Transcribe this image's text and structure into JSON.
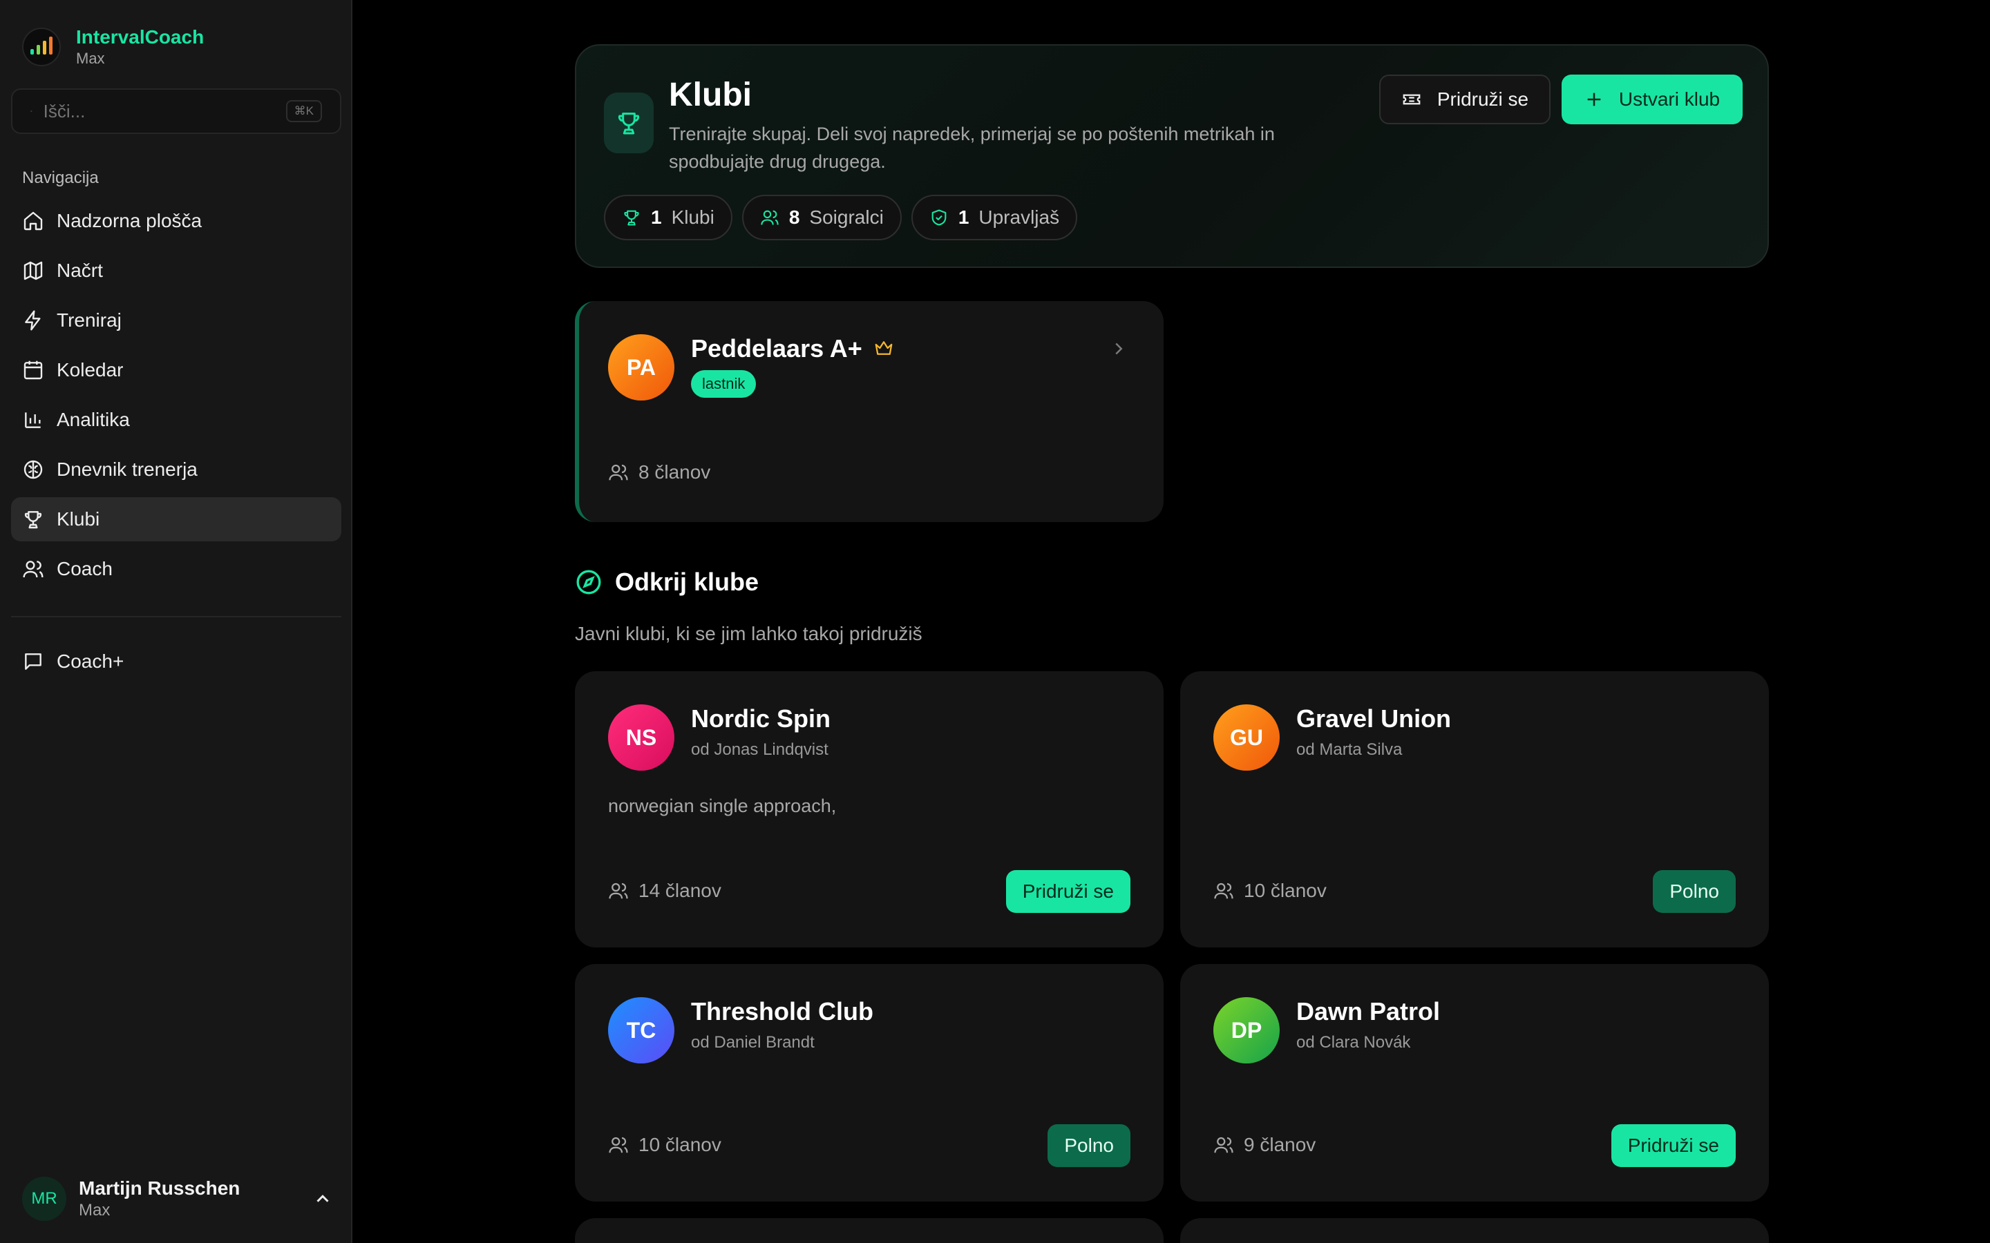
{
  "app": {
    "name": "IntervalCoach",
    "subtitle": "Max"
  },
  "search": {
    "placeholder": "Išči...",
    "shortcut": "⌘K"
  },
  "nav": {
    "title": "Navigacija",
    "items": [
      {
        "label": "Nadzorna plošča",
        "icon": "home-icon"
      },
      {
        "label": "Načrt",
        "icon": "map-icon"
      },
      {
        "label": "Treniraj",
        "icon": "bolt-icon"
      },
      {
        "label": "Koledar",
        "icon": "calendar-icon"
      },
      {
        "label": "Analitika",
        "icon": "bar-chart-icon"
      },
      {
        "label": "Dnevnik trenerja",
        "icon": "brain-icon"
      },
      {
        "label": "Klubi",
        "icon": "trophy-icon",
        "active": true
      },
      {
        "label": "Coach",
        "icon": "users-icon"
      }
    ],
    "coach_plus": "Coach+"
  },
  "user": {
    "initials": "MR",
    "name": "Martijn Russchen",
    "subtitle": "Max"
  },
  "hero": {
    "title": "Klubi",
    "description": "Trenirajte skupaj. Deli svoj napredek, primerjaj se po poštenih metrikah in spodbujajte drug drugega.",
    "join_label": "Pridruži se",
    "create_label": "Ustvari klub",
    "stats": [
      {
        "value": "1",
        "label": "Klubi"
      },
      {
        "value": "8",
        "label": "Soigralci"
      },
      {
        "value": "1",
        "label": "Upravljaš"
      }
    ]
  },
  "my_club": {
    "initials": "PA",
    "name": "Peddelaars A+",
    "role": "lastnik",
    "members": "8 članov"
  },
  "discover": {
    "title": "Odkrij klube",
    "subtitle": "Javni klubi, ki se jim lahko takoj pridružiš",
    "clubs": [
      {
        "initials": "NS",
        "name": "Nordic Spin",
        "owner": "od Jonas Lindqvist",
        "description": "norwegian single approach,",
        "members": "14 članov",
        "action": "Pridruži se",
        "full": false
      },
      {
        "initials": "GU",
        "name": "Gravel Union",
        "owner": "od Marta Silva",
        "description": "",
        "members": "10 članov",
        "action": "Polno",
        "full": true
      },
      {
        "initials": "TC",
        "name": "Threshold Club",
        "owner": "od Daniel Brandt",
        "description": "",
        "members": "10 članov",
        "action": "Polno",
        "full": true
      },
      {
        "initials": "DP",
        "name": "Dawn Patrol",
        "owner": "od Clara Novák",
        "description": "",
        "members": "9 članov",
        "action": "Pridruži se",
        "full": false
      }
    ]
  },
  "colors": {
    "accent": "#19e5a3",
    "accent_dark": "#0c6b4a",
    "owner_crown": "#f5b82e"
  }
}
